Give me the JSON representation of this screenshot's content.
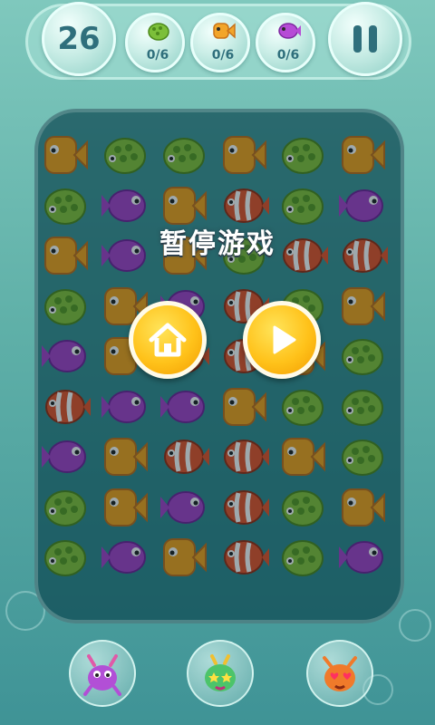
{
  "hud": {
    "moves_left": "26",
    "goals": [
      {
        "name": "turtle-goal-icon",
        "count": "0/6",
        "color": "#7cbf3a"
      },
      {
        "name": "orange-fish-goal-icon",
        "count": "0/6",
        "color": "#f2a52a"
      },
      {
        "name": "purple-fish-goal-icon",
        "count": "0/6",
        "color": "#b64bd6"
      }
    ]
  },
  "pause_menu": {
    "title": "暂停游戏",
    "home_button": "home-icon",
    "resume_button": "play-icon"
  },
  "board": {
    "rows": 9,
    "cols": 6,
    "tiles": [
      [
        "orange",
        "turtle",
        "turtle",
        "orange",
        "turtle",
        "orange"
      ],
      [
        "turtle",
        "purple",
        "orange",
        "clown",
        "turtle",
        "purple"
      ],
      [
        "orange",
        "purple",
        "orange",
        "turtle",
        "clown",
        "clown"
      ],
      [
        "turtle",
        "orange",
        "purple",
        "clown",
        "turtle",
        "orange"
      ],
      [
        "purple",
        "orange",
        "clown",
        "clown",
        "orange",
        "turtle"
      ],
      [
        "clown",
        "purple",
        "purple",
        "orange",
        "turtle",
        "turtle"
      ],
      [
        "purple",
        "orange",
        "clown",
        "clown",
        "orange",
        "turtle"
      ],
      [
        "turtle",
        "orange",
        "purple",
        "clown",
        "turtle",
        "orange"
      ],
      [
        "turtle",
        "purple",
        "orange",
        "clown",
        "turtle",
        "purple"
      ]
    ],
    "colors": {
      "orange": "#f4a31c",
      "turtle": "#86c43a",
      "purple": "#a743c9",
      "clown": "#e7542a"
    }
  },
  "boosters": [
    {
      "name": "purple-crab-booster-icon"
    },
    {
      "name": "starry-eyed-creature-booster-icon"
    },
    {
      "name": "heart-eyed-crab-booster-icon"
    }
  ]
}
